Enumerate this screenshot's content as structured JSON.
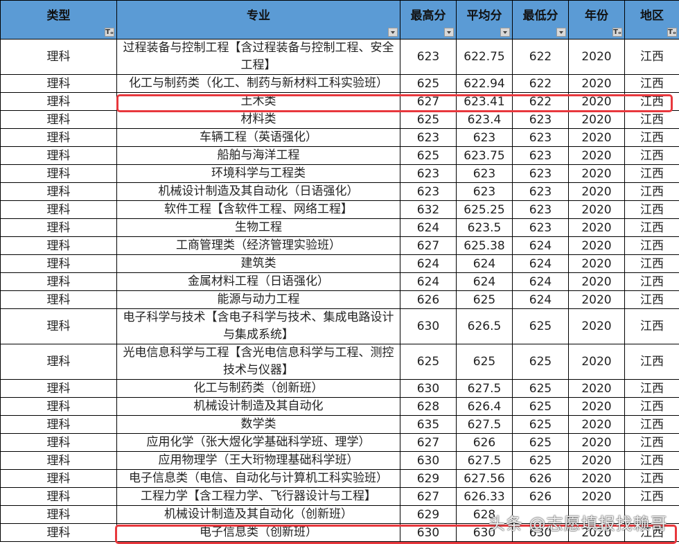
{
  "headers": [
    {
      "label": "类型",
      "filter_icon": "filter-applied-icon"
    },
    {
      "label": "专业",
      "filter_icon": "dropdown-arrow-icon"
    },
    {
      "label": "最高分",
      "filter_icon": "dropdown-arrow-icon"
    },
    {
      "label": "平均分",
      "filter_icon": "dropdown-arrow-icon"
    },
    {
      "label": "最低分",
      "filter_icon": "dropdown-arrow-icon"
    },
    {
      "label": "年份",
      "filter_icon": "filter-applied-icon"
    },
    {
      "label": "地区",
      "filter_icon": "filter-applied-icon"
    }
  ],
  "rows": [
    {
      "type": "理科",
      "major": "过程装备与控制工程【含过程装备与控制工程、安全工程】",
      "max": "623",
      "avg": "622.75",
      "min": "622",
      "year": "2020",
      "region": "江西",
      "tall": true
    },
    {
      "type": "理科",
      "major": "化工与制药类（化工、制药与新材料工科实验班）",
      "max": "625",
      "avg": "622.94",
      "min": "622",
      "year": "2020",
      "region": "江西"
    },
    {
      "type": "理科",
      "major": "土木类",
      "max": "627",
      "avg": "623.41",
      "min": "622",
      "year": "2020",
      "region": "江西",
      "highlighted": true
    },
    {
      "type": "理科",
      "major": "材料类",
      "max": "625",
      "avg": "623.4",
      "min": "623",
      "year": "2020",
      "region": "江西"
    },
    {
      "type": "理科",
      "major": "车辆工程（英语强化）",
      "max": "623",
      "avg": "623",
      "min": "623",
      "year": "2020",
      "region": "江西"
    },
    {
      "type": "理科",
      "major": "船舶与海洋工程",
      "max": "625",
      "avg": "623.75",
      "min": "623",
      "year": "2020",
      "region": "江西"
    },
    {
      "type": "理科",
      "major": "环境科学与工程类",
      "max": "623",
      "avg": "623",
      "min": "623",
      "year": "2020",
      "region": "江西"
    },
    {
      "type": "理科",
      "major": "机械设计制造及其自动化（日语强化）",
      "max": "623",
      "avg": "623",
      "min": "623",
      "year": "2020",
      "region": "江西"
    },
    {
      "type": "理科",
      "major": "软件工程【含软件工程、网络工程】",
      "max": "632",
      "avg": "625.25",
      "min": "623",
      "year": "2020",
      "region": "江西"
    },
    {
      "type": "理科",
      "major": "生物工程",
      "max": "624",
      "avg": "623.5",
      "min": "623",
      "year": "2020",
      "region": "江西"
    },
    {
      "type": "理科",
      "major": "工商管理类（经济管理实验班）",
      "max": "627",
      "avg": "625.38",
      "min": "624",
      "year": "2020",
      "region": "江西"
    },
    {
      "type": "理科",
      "major": "建筑类",
      "max": "624",
      "avg": "624",
      "min": "624",
      "year": "2020",
      "region": "江西"
    },
    {
      "type": "理科",
      "major": "金属材料工程（日语强化）",
      "max": "624",
      "avg": "624",
      "min": "624",
      "year": "2020",
      "region": "江西"
    },
    {
      "type": "理科",
      "major": "能源与动力工程",
      "max": "626",
      "avg": "625",
      "min": "624",
      "year": "2020",
      "region": "江西"
    },
    {
      "type": "理科",
      "major": "电子科学与技术【含电子科学与技术、集成电路设计与集成系统】",
      "max": "630",
      "avg": "626.5",
      "min": "625",
      "year": "2020",
      "region": "江西",
      "tall": true
    },
    {
      "type": "理科",
      "major": "光电信息科学与工程【含光电信息科学与工程、测控技术与仪器】",
      "max": "625",
      "avg": "625",
      "min": "625",
      "year": "2020",
      "region": "江西",
      "tall": true
    },
    {
      "type": "理科",
      "major": "化工与制药类（创新班）",
      "max": "630",
      "avg": "627.5",
      "min": "625",
      "year": "2020",
      "region": "江西"
    },
    {
      "type": "理科",
      "major": "机械设计制造及其自动化",
      "max": "628",
      "avg": "626.4",
      "min": "625",
      "year": "2020",
      "region": "江西"
    },
    {
      "type": "理科",
      "major": "数学类",
      "max": "635",
      "avg": "627.5",
      "min": "625",
      "year": "2020",
      "region": "江西"
    },
    {
      "type": "理科",
      "major": "应用化学（张大煜化学基础科学班、理学）",
      "max": "627",
      "avg": "626",
      "min": "625",
      "year": "2020",
      "region": "江西"
    },
    {
      "type": "理科",
      "major": "应用物理学（王大珩物理基础科学班）",
      "max": "630",
      "avg": "627.5",
      "min": "625",
      "year": "2020",
      "region": "江西"
    },
    {
      "type": "理科",
      "major": "电子信息类（电信、自动化与计算机工科实验班）",
      "max": "629",
      "avg": "627.56",
      "min": "626",
      "year": "2020",
      "region": "江西"
    },
    {
      "type": "理科",
      "major": "工程力学【含工程力学、飞行器设计与工程】",
      "max": "627",
      "avg": "626.33",
      "min": "626",
      "year": "2020",
      "region": "江西"
    },
    {
      "type": "理科",
      "major": "机械设计制造及其自动化（创新班）",
      "max": "629",
      "avg": "628",
      "min": "",
      "year": "",
      "region": ""
    },
    {
      "type": "理科",
      "major": "电子信息类（创新班）",
      "max": "630",
      "avg": "630",
      "min": "630",
      "year": "2020",
      "region": "江西",
      "highlighted": true
    }
  ],
  "watermark": "头条 @志愿填报找赖哥",
  "colors": {
    "header_bg": "#5b9bd5",
    "highlight_border": "#e8383d"
  }
}
